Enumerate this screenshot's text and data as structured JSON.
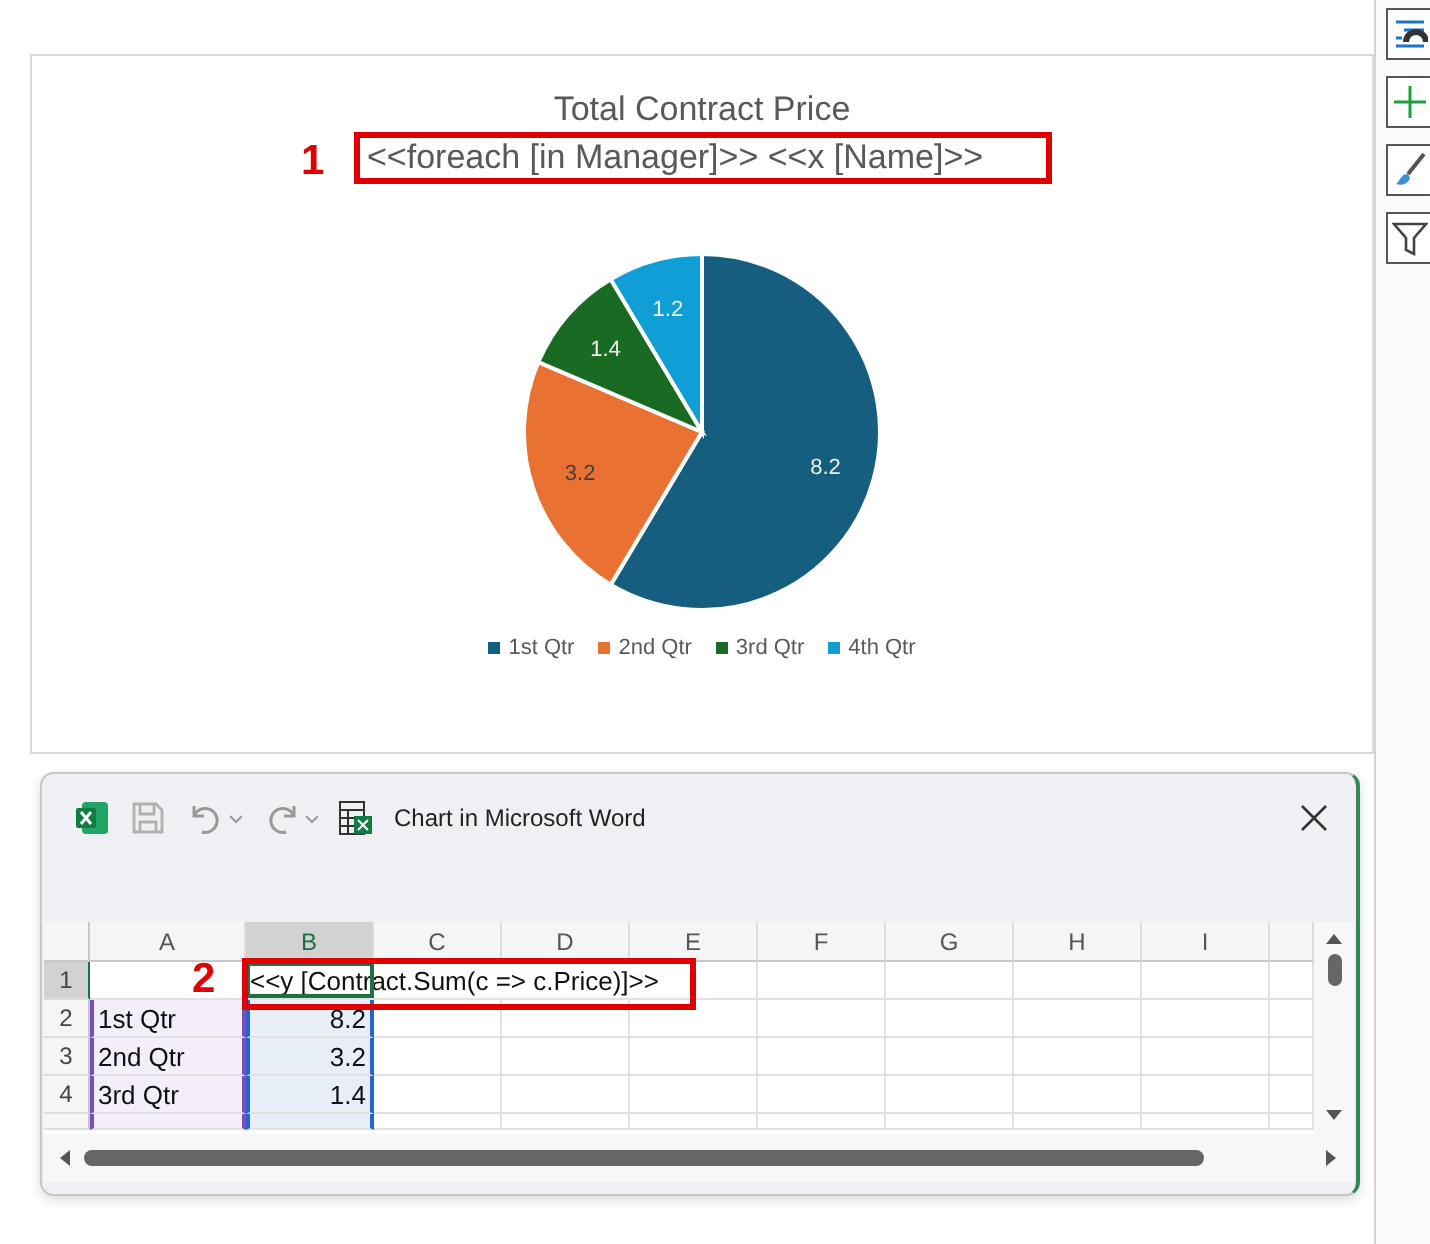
{
  "chart": {
    "subtitle": "<<foreach [in  Manager]>> <<x [Name]>>",
    "chart_data": {
      "type": "pie",
      "title": "Total Contract Price",
      "categories": [
        "1st Qtr",
        "2nd Qtr",
        "3rd Qtr",
        "4th Qtr"
      ],
      "values": [
        8.2,
        3.2,
        1.4,
        1.2
      ],
      "colors": [
        "#165e80",
        "#e97132",
        "#196b24",
        "#0f9ed5"
      ],
      "data_labels": true
    }
  },
  "side_tools": [
    {
      "kind": "elements"
    },
    {
      "kind": "add"
    },
    {
      "kind": "style"
    },
    {
      "kind": "filter"
    }
  ],
  "window": {
    "title": "Chart in Microsoft Word",
    "save_disabled": true
  },
  "sheet": {
    "columns": [
      {
        "label": "A",
        "selected": false
      },
      {
        "label": "B",
        "selected": true
      },
      {
        "label": "C",
        "selected": false
      },
      {
        "label": "D",
        "selected": false
      },
      {
        "label": "E",
        "selected": false
      },
      {
        "label": "F",
        "selected": false
      },
      {
        "label": "G",
        "selected": false
      },
      {
        "label": "H",
        "selected": false
      },
      {
        "label": "I",
        "selected": false
      }
    ],
    "rows": [
      {
        "header": "1",
        "selected": true,
        "value": "<<y [Contract.Sum(c => c.Price)]>>"
      },
      {
        "header": "2",
        "selected": false,
        "label": "1st Qtr",
        "value": "8.2"
      },
      {
        "header": "3",
        "selected": false,
        "label": "2nd Qtr",
        "value": "3.2"
      },
      {
        "header": "4",
        "selected": false,
        "label": "3rd Qtr",
        "value": "1.4"
      }
    ]
  },
  "annotations": [
    {
      "label": "1"
    },
    {
      "label": "2"
    }
  ]
}
